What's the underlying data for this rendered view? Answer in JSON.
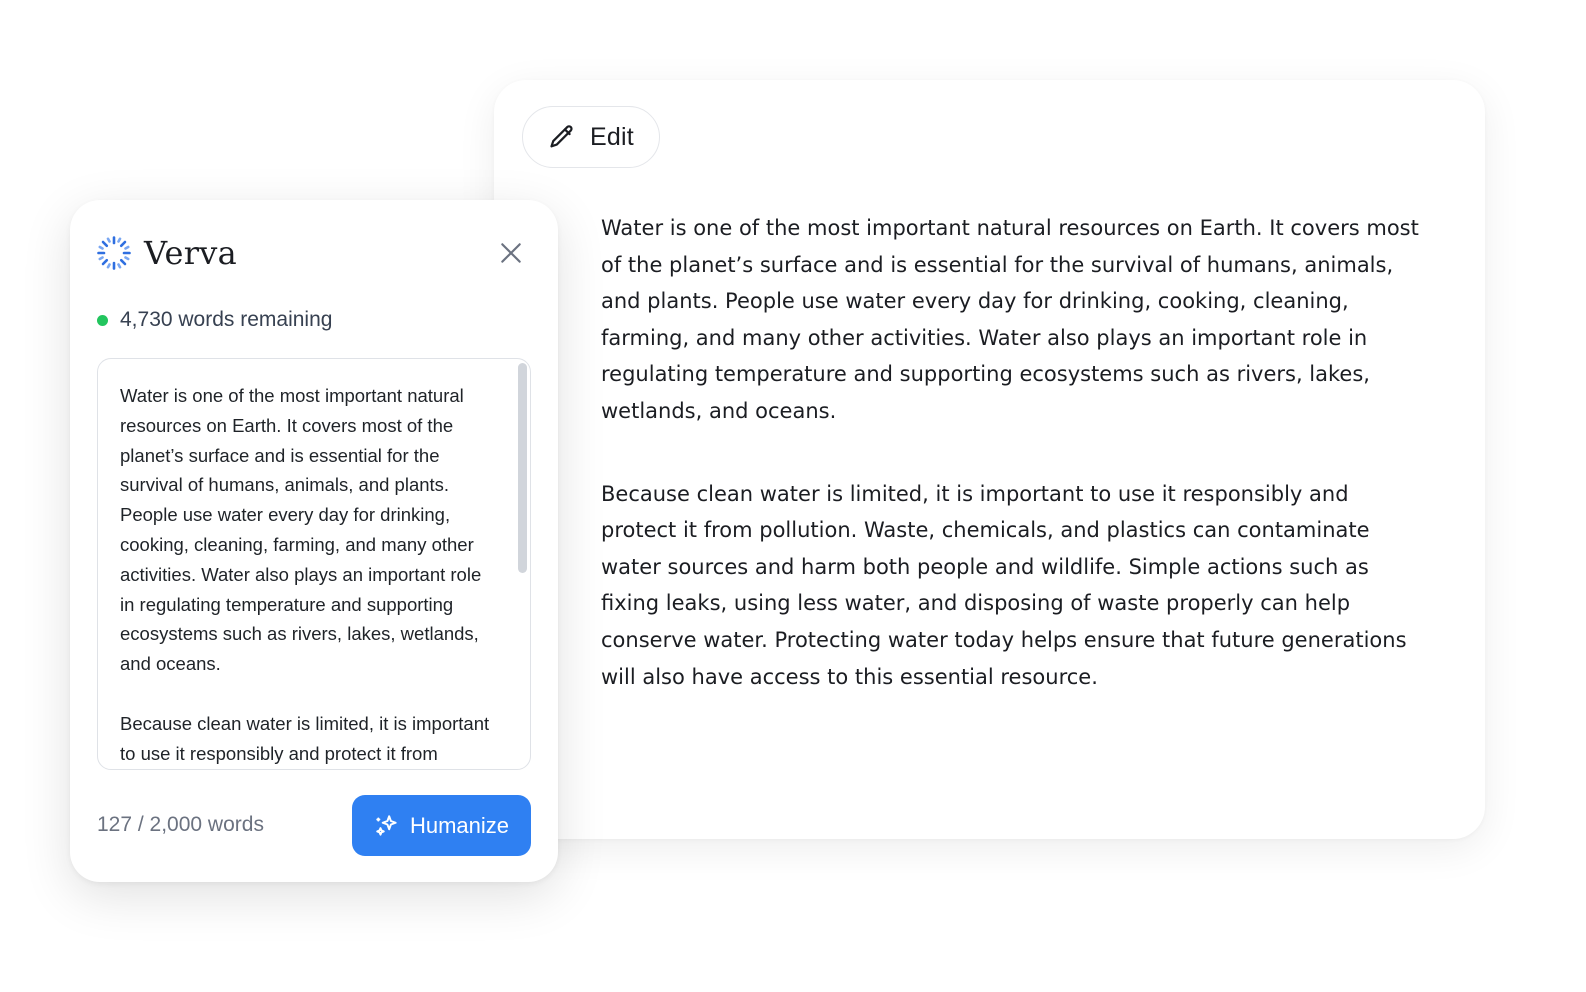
{
  "document": {
    "edit_label": "Edit",
    "paragraphs": [
      "Water is one of the most important natural resources on Earth. It covers most of the planet’s surface and is essential for the survival of humans, animals, and plants. People use water every day for drinking, cooking, cleaning, farming, and many other activities. Water also plays an important role in regulating temperature and supporting ecosystems such as rivers, lakes, wetlands, and oceans.",
      "Because clean water is limited, it is important to use it responsibly and protect it from pollution. Waste, chemicals, and plastics can contaminate water sources and harm both people and wildlife. Simple actions such as fixing leaks, using less water, and disposing of waste properly can help conserve water. Protecting water today helps ensure that future generations will also have access to this essential resource."
    ]
  },
  "panel": {
    "brand": "Verva",
    "logo_icon": "dashed-circle-icon",
    "status_text": "4,730 words remaining",
    "status_color": "#22c55e",
    "input_paragraphs": [
      "Water is one of the most important natural resources on Earth. It covers most of the planet’s surface and is essential for the survival of humans, animals, and plants. People use water every day for drinking, cooking, cleaning, farming, and many other activities. Water also plays an important role in regulating temperature and supporting ecosystems such as rivers, lakes, wetlands, and oceans.",
      "Because clean water is limited, it is important to use it responsibly and protect it from pollution. Waste, chemicals, and plastics can contaminate water sources and harm both people and wildlife."
    ],
    "word_count": "127 / 2,000 words",
    "humanize_label": "Humanize",
    "accent_color": "#2f80f2"
  }
}
